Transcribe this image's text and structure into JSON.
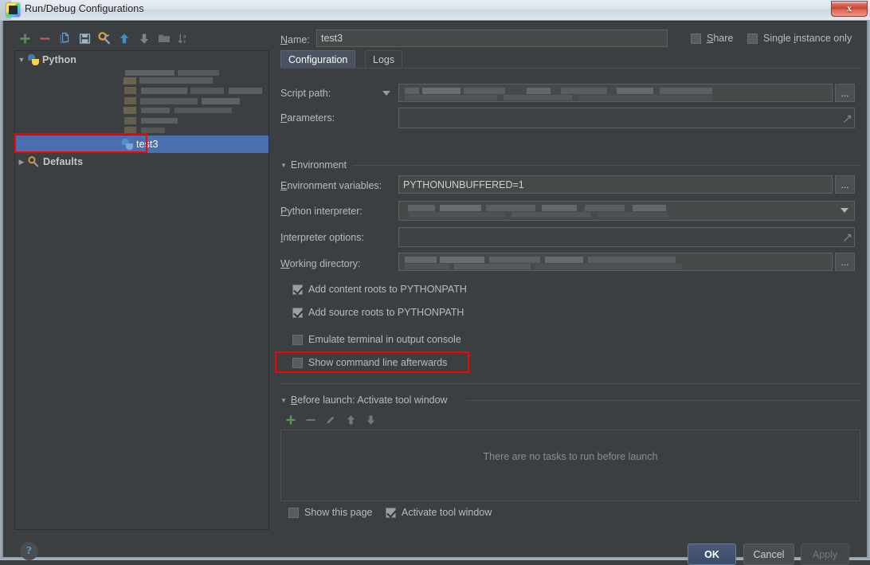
{
  "window": {
    "title": "Run/Debug Configurations",
    "close_label": "x",
    "app_icon": "pycharm-icon"
  },
  "left_toolbar": {
    "buttons": [
      {
        "name": "add-configuration-button",
        "icon": "plus-icon",
        "tooltip": "Add New Configuration"
      },
      {
        "name": "remove-configuration-button",
        "icon": "minus-icon",
        "tooltip": "Remove Configuration"
      },
      {
        "name": "copy-configuration-button",
        "icon": "copy-icon",
        "tooltip": "Copy Configuration"
      },
      {
        "name": "save-configuration-button",
        "icon": "save-icon",
        "tooltip": "Save Configuration"
      },
      {
        "name": "edit-defaults-button",
        "icon": "wrench-gear-icon",
        "tooltip": "Edit defaults"
      },
      {
        "name": "move-up-button",
        "icon": "arrow-up-icon",
        "tooltip": "Move Up"
      },
      {
        "name": "move-down-button",
        "icon": "arrow-down-icon",
        "tooltip": "Move Down"
      },
      {
        "name": "new-folder-button",
        "icon": "folder-icon",
        "tooltip": "Create New Folder"
      },
      {
        "name": "sort-button",
        "icon": "sort-az-icon",
        "tooltip": "Sort Configurations"
      }
    ]
  },
  "tree": {
    "nodes": [
      {
        "label": "Python",
        "icon": "python-icon",
        "expanded": true,
        "level": 0,
        "selected": false,
        "blurred": false
      },
      {
        "label": "",
        "icon": "python-icon",
        "expanded": false,
        "level": 1,
        "selected": false,
        "blurred": true
      },
      {
        "label": "",
        "icon": "python-icon",
        "expanded": false,
        "level": 1,
        "selected": false,
        "blurred": true
      },
      {
        "label": "",
        "icon": "python-icon",
        "expanded": false,
        "level": 1,
        "selected": false,
        "blurred": true
      },
      {
        "label": "",
        "icon": "python-icon",
        "expanded": false,
        "level": 1,
        "selected": false,
        "blurred": true
      },
      {
        "label": "test3",
        "icon": "python-icon",
        "expanded": false,
        "level": 1,
        "selected": true,
        "blurred": false
      },
      {
        "label": "Defaults",
        "icon": "wrench-gear-icon",
        "expanded": false,
        "level": 0,
        "selected": false,
        "blurred": false
      }
    ],
    "selected_node": "test3"
  },
  "header": {
    "name_label": "Name:",
    "name_value": "test3",
    "share_label": "Share",
    "share_checked": false,
    "single_instance_label": "Single instance only",
    "single_instance_checked": false
  },
  "tabs": [
    {
      "label": "Configuration",
      "active": true
    },
    {
      "label": "Logs",
      "active": false
    }
  ],
  "configuration": {
    "script_path_label": "Script path:",
    "script_path_value": "",
    "script_path_blurred": true,
    "parameters_label": "Parameters:",
    "parameters_value": "",
    "browse_label": "...",
    "environment_section": "Environment",
    "environment_variables_label": "Environment variables:",
    "environment_variables_value": "PYTHONUNBUFFERED=1",
    "python_interpreter_label": "Python interpreter:",
    "python_interpreter_value": "",
    "python_interpreter_blurred": true,
    "interpreter_options_label": "Interpreter options:",
    "interpreter_options_value": "",
    "working_directory_label": "Working directory:",
    "working_directory_value": "",
    "working_directory_blurred": true,
    "checkboxes": [
      {
        "label": "Add content roots to PYTHONPATH",
        "checked": true,
        "highlighted": false
      },
      {
        "label": "Add source roots to PYTHONPATH",
        "checked": true,
        "highlighted": false
      },
      {
        "label": "Emulate terminal in output console",
        "checked": false,
        "highlighted": false
      },
      {
        "label": "Show command line afterwards",
        "checked": false,
        "highlighted": true
      }
    ]
  },
  "before_launch": {
    "section_label": "Before launch: Activate tool window",
    "buttons": [
      {
        "name": "add-task-button",
        "icon": "plus-icon",
        "enabled": true
      },
      {
        "name": "remove-task-button",
        "icon": "minus-icon",
        "enabled": false
      },
      {
        "name": "edit-task-button",
        "icon": "pencil-icon",
        "enabled": false
      },
      {
        "name": "move-task-up-button",
        "icon": "arrow-up-icon",
        "enabled": false
      },
      {
        "name": "move-task-down-button",
        "icon": "arrow-down-icon",
        "enabled": false
      }
    ],
    "empty_message": "There are no tasks to run before launch",
    "show_page_label": "Show this page",
    "show_page_checked": false,
    "activate_tool_window_label": "Activate tool window",
    "activate_tool_window_checked": true
  },
  "footer": {
    "help_label": "?",
    "ok_label": "OK",
    "cancel_label": "Cancel",
    "apply_label": "Apply",
    "apply_enabled": false
  },
  "colors": {
    "background": "#3c3f41",
    "selection": "#4b6eaf",
    "annotation": "#ff0000",
    "accent_green": "#5a9b4e",
    "accent_blue": "#3592c4"
  }
}
